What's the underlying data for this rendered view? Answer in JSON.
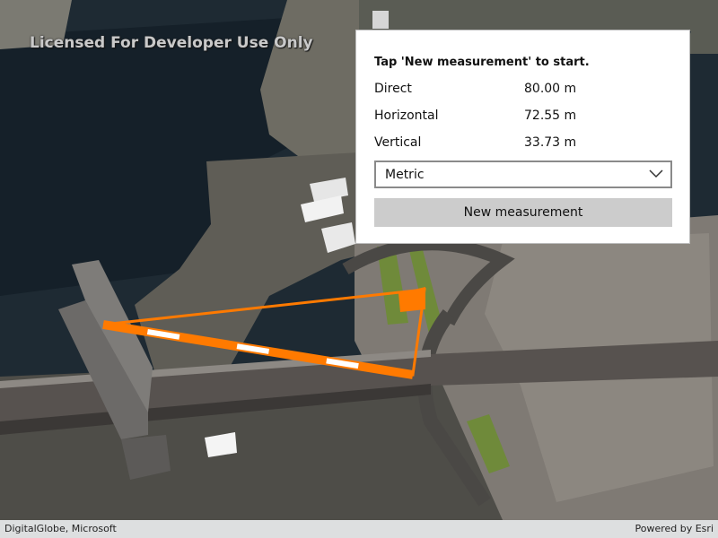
{
  "map": {
    "watermark": "Licensed For Developer Use Only",
    "attribution": "DigitalGlobe, Microsoft",
    "powered_by": "Powered by Esri",
    "measure_line_color": "#ff7a00"
  },
  "panel": {
    "instructions": "Tap 'New measurement' to start.",
    "rows": [
      {
        "label": "Direct",
        "value": "80.00 m"
      },
      {
        "label": "Horizontal",
        "value": "72.55 m"
      },
      {
        "label": "Vertical",
        "value": "33.73 m"
      }
    ],
    "unit_system": {
      "selected": "Metric"
    },
    "new_measurement_label": "New measurement"
  }
}
